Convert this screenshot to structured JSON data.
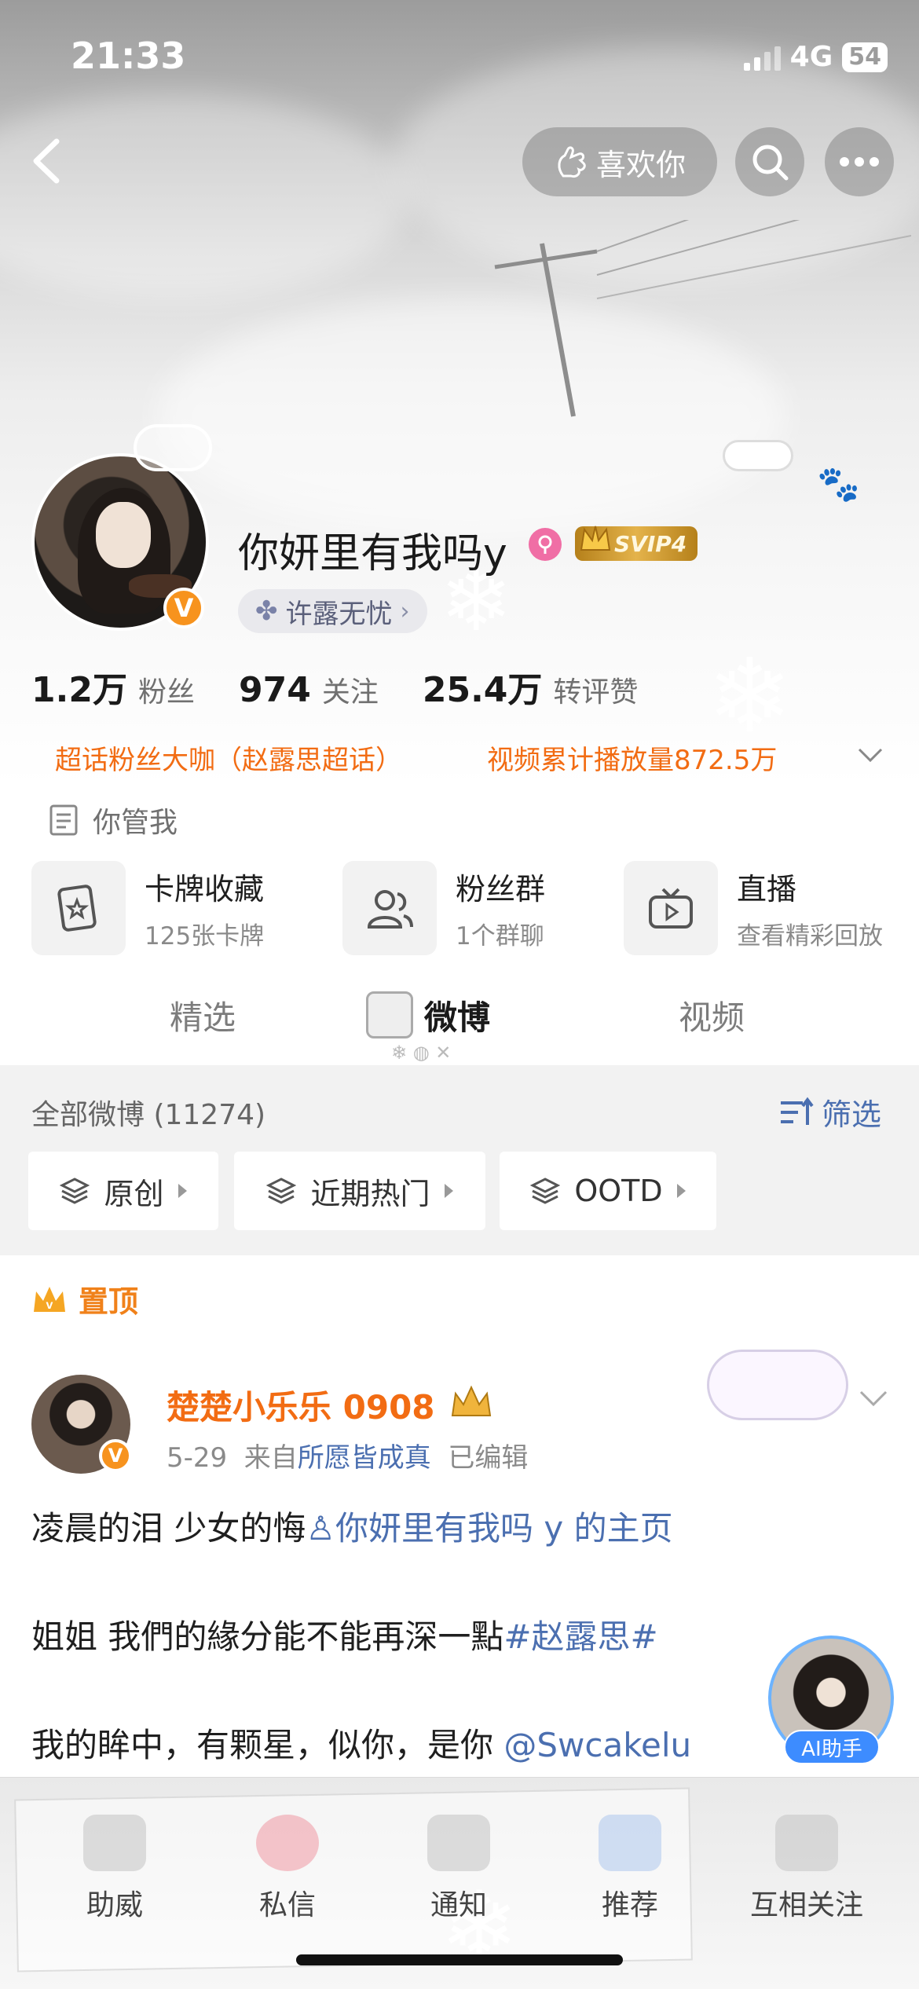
{
  "status_bar": {
    "time": "21:33",
    "network": "4G",
    "battery": "54"
  },
  "top_nav": {
    "like_label": "喜欢你"
  },
  "profile": {
    "username": "你妍里有我吗y",
    "svip_label": "SVIP4",
    "fan_group": "许露无忧",
    "verified_badge": "V"
  },
  "stats": [
    {
      "value": "1.2万",
      "label": "粉丝"
    },
    {
      "value": "974",
      "label": "关注"
    },
    {
      "value": "25.4万",
      "label": "转评赞"
    }
  ],
  "tags": {
    "left": "超话粉丝大咖（赵露思超话）",
    "right": "视频累计播放量872.5万"
  },
  "bio": "你管我",
  "quick_cards": [
    {
      "title": "卡牌收藏",
      "subtitle": "125张卡牌"
    },
    {
      "title": "粉丝群",
      "subtitle": "1个群聊"
    },
    {
      "title": "直播",
      "subtitle": "查看精彩回放"
    }
  ],
  "tabs": [
    "精选",
    "微博",
    "视频"
  ],
  "feed": {
    "count_label": "全部微博 (11274)",
    "filter_label": "筛选",
    "chips": [
      "原创",
      "近期热门",
      "OOTD"
    ]
  },
  "post": {
    "pinned_label": "置顶",
    "author": "楚楚小乐乐 0908",
    "date": "5-29",
    "from_prefix": "来自",
    "source": "所愿皆成真",
    "edited": "已编辑",
    "line1_text": "凌晨的泪 少女的悔",
    "line1_link": "你妍里有我吗 y 的主页",
    "line2_text": "姐姐 我們的緣分能不能再深一點",
    "line2_topic": "#赵露思#",
    "line3_text": "我的眸中，有颗星，似你，是你",
    "line3_mention": "@Swcakelu"
  },
  "ai_helper_label": "AI助手",
  "bottom_bar": [
    "助威",
    "私信",
    "通知",
    "推荐",
    "互相关注"
  ],
  "colors": {
    "orange": "#f26c13",
    "link_blue": "#4b6fb0",
    "svip_gold": "#e4b34b"
  }
}
